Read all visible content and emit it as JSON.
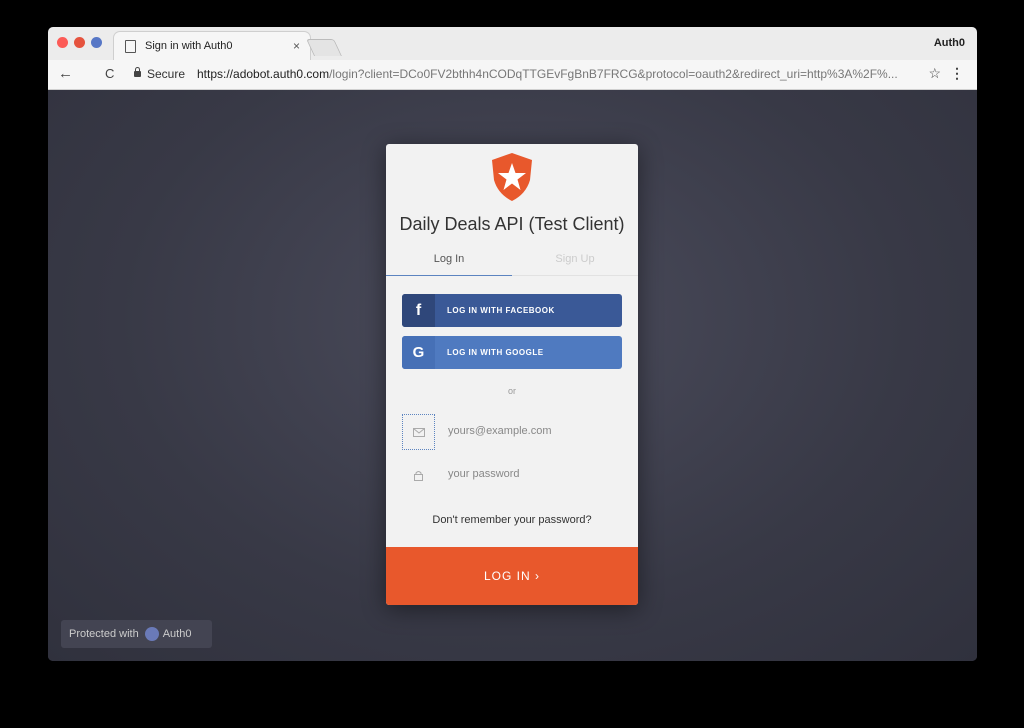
{
  "browser": {
    "tab_title": "Sign in with Auth0",
    "tab_close": "×",
    "profile_name": "Auth0",
    "secure_label": "Secure",
    "url_host": "https://adobot.auth0.com",
    "url_path": "/login?client=DCo0FV2bthh4nCODqTTGEvFgBnB7FRCG&protocol=oauth2&redirect_uri=http%3A%2F%...",
    "back_icon": "←",
    "reload_icon": "C",
    "star_icon": "☆",
    "menu_icon": "⋮"
  },
  "login": {
    "title": "Daily Deals API (Test Client)",
    "tab_login": "Log In",
    "tab_signup": "Sign Up",
    "facebook_label": "LOG IN WITH FACEBOOK",
    "facebook_glyph": "f",
    "google_label": "LOG IN WITH GOOGLE",
    "google_glyph": "G",
    "or_text": "or",
    "email_placeholder": "yours@example.com",
    "password_placeholder": "your password",
    "forgot_link": "Don't remember your password?",
    "submit_label": "LOG IN ›",
    "brand_color": "#e8582c"
  },
  "footer": {
    "protected_text": "Protected with",
    "brand": "Auth0"
  }
}
